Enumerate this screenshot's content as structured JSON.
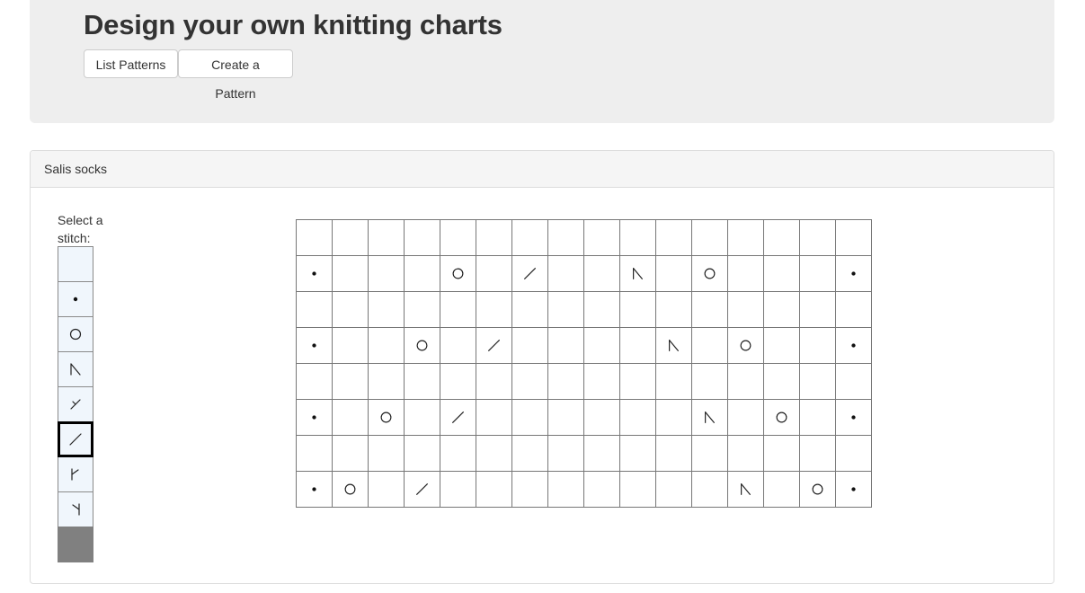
{
  "header": {
    "title": "Design your own knitting charts",
    "list_patterns_label": "List Patterns",
    "create_pattern_label": "Create a Pattern"
  },
  "pattern": {
    "name": "Salis socks",
    "select_label": "Select a stitch:",
    "palette": [
      "knit",
      "purl",
      "yarn-over",
      "ssk",
      "sk2p",
      "k2tog",
      "m1l",
      "m1r",
      "no-stitch"
    ],
    "selected": "k2tog",
    "chart_rows": [
      [
        "knit",
        "knit",
        "knit",
        "knit",
        "knit",
        "knit",
        "knit",
        "knit",
        "knit",
        "knit",
        "knit",
        "knit",
        "knit",
        "knit",
        "knit",
        "knit"
      ],
      [
        "purl",
        "knit",
        "knit",
        "knit",
        "yarn-over",
        "knit",
        "k2tog",
        "knit",
        "knit",
        "ssk",
        "knit",
        "yarn-over",
        "knit",
        "knit",
        "knit",
        "purl"
      ],
      [
        "knit",
        "knit",
        "knit",
        "knit",
        "knit",
        "knit",
        "knit",
        "knit",
        "knit",
        "knit",
        "knit",
        "knit",
        "knit",
        "knit",
        "knit",
        "knit"
      ],
      [
        "purl",
        "knit",
        "knit",
        "yarn-over",
        "knit",
        "k2tog",
        "knit",
        "knit",
        "knit",
        "knit",
        "ssk",
        "knit",
        "yarn-over",
        "knit",
        "knit",
        "purl"
      ],
      [
        "knit",
        "knit",
        "knit",
        "knit",
        "knit",
        "knit",
        "knit",
        "knit",
        "knit",
        "knit",
        "knit",
        "knit",
        "knit",
        "knit",
        "knit",
        "knit"
      ],
      [
        "purl",
        "knit",
        "yarn-over",
        "knit",
        "k2tog",
        "knit",
        "knit",
        "knit",
        "knit",
        "knit",
        "knit",
        "ssk",
        "knit",
        "yarn-over",
        "knit",
        "purl"
      ],
      [
        "knit",
        "knit",
        "knit",
        "knit",
        "knit",
        "knit",
        "knit",
        "knit",
        "knit",
        "knit",
        "knit",
        "knit",
        "knit",
        "knit",
        "knit",
        "knit"
      ],
      [
        "purl",
        "yarn-over",
        "knit",
        "k2tog",
        "knit",
        "knit",
        "knit",
        "knit",
        "knit",
        "knit",
        "knit",
        "knit",
        "ssk",
        "knit",
        "yarn-over",
        "purl"
      ]
    ]
  }
}
